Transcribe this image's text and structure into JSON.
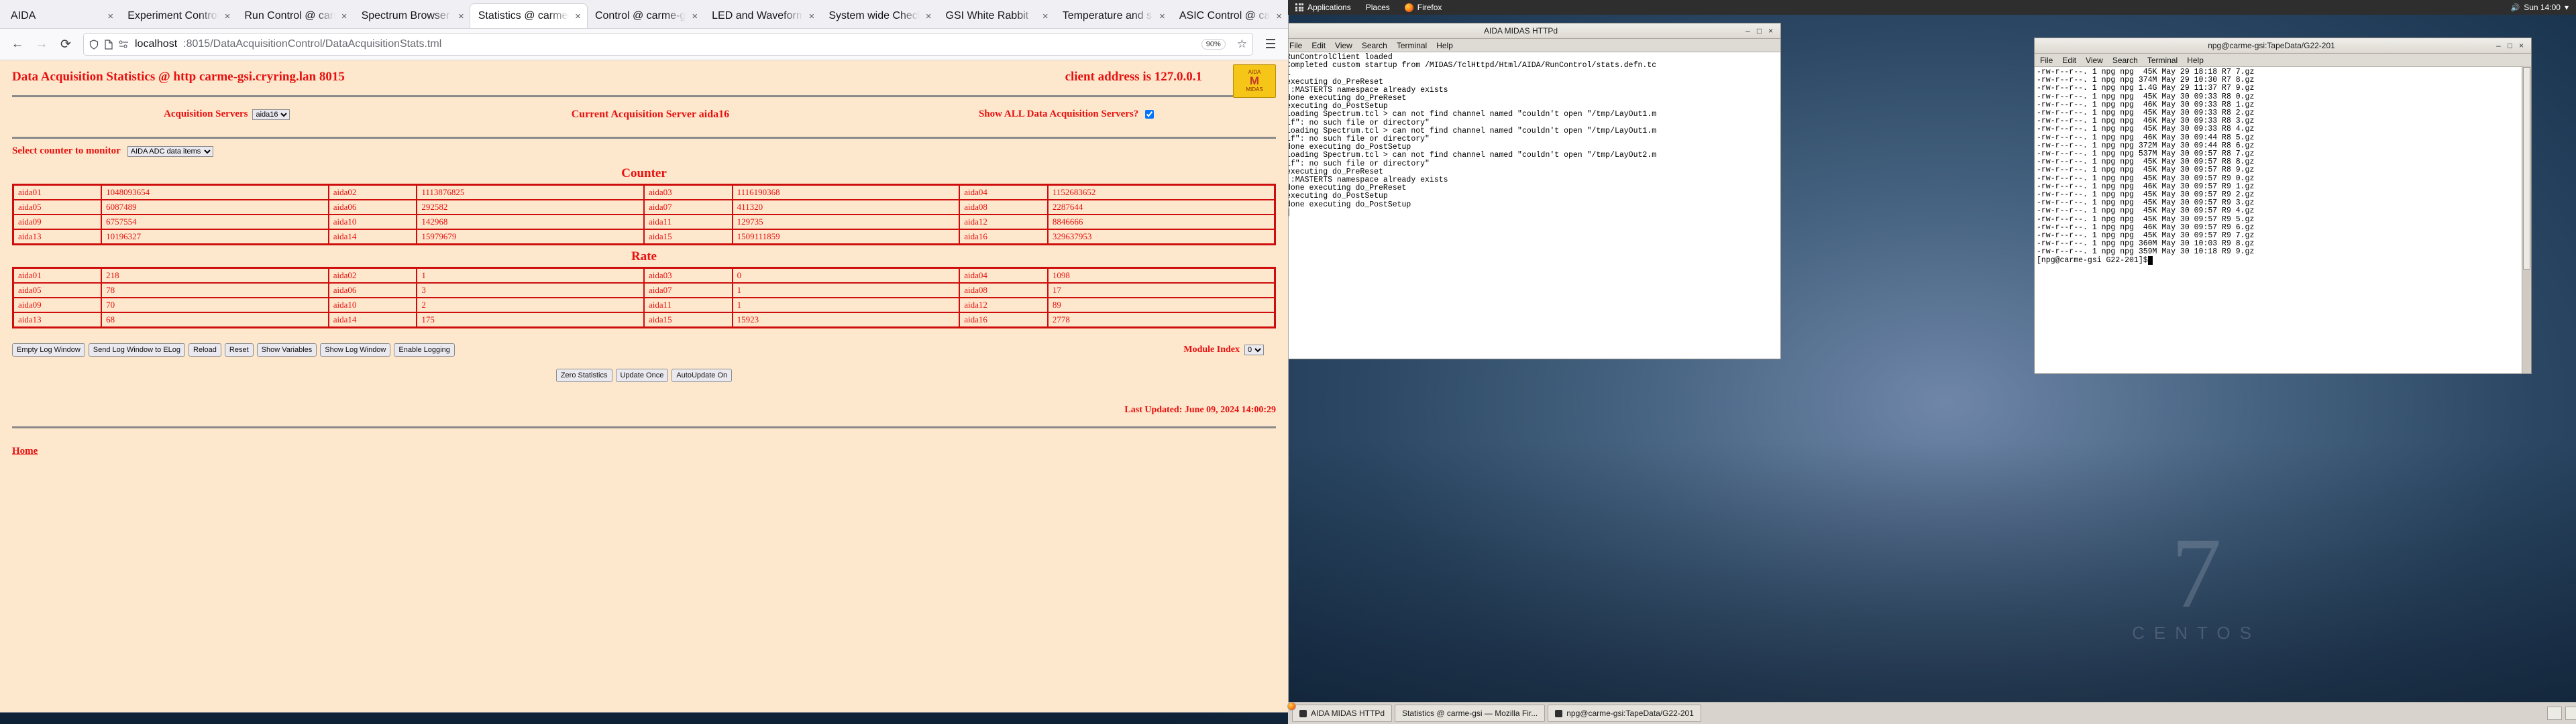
{
  "gnome_panel": {
    "activities": "Applications",
    "places": "Places",
    "app": "Firefox",
    "clock": "Sun 14:00"
  },
  "browser": {
    "tabs": [
      {
        "label": "AIDA",
        "active": false
      },
      {
        "label": "Experiment Control @",
        "active": false
      },
      {
        "label": "Run Control @ carme",
        "active": false
      },
      {
        "label": "Spectrum Browser @",
        "active": false
      },
      {
        "label": "Statistics @ carme-",
        "active": true
      },
      {
        "label": "Control @ carme-g",
        "active": false
      },
      {
        "label": "LED and Waveform",
        "active": false
      },
      {
        "label": "System wide Check",
        "active": false
      },
      {
        "label": "GSI White Rabbit",
        "active": false
      },
      {
        "label": "Temperature and s",
        "active": false
      },
      {
        "label": "ASIC Control @ ca",
        "active": false
      }
    ],
    "close_glyph": "×",
    "nav": {
      "back": "←",
      "forward": "→",
      "reload": "⟳"
    },
    "url_host": "localhost",
    "url_rest": ":8015/DataAcquisitionControl/DataAcquisitionStats.tml",
    "zoom_level": "90%",
    "shield_icon": "shield-icon",
    "page_icon": "page-icon",
    "reader_icon": "reader-icon",
    "bookmark_icon": "☆"
  },
  "page": {
    "title": "Data Acquisition Statistics @ http carme-gsi.cryring.lan 8015",
    "client_address": "client address is 127.0.0.1",
    "acq_servers_label": "Acquisition Servers",
    "acq_servers_value": "aida16",
    "current_server": "Current Acquisition Server aida16",
    "show_all_label": "Show ALL Data Acquisition Servers?",
    "show_all_checked": true,
    "select_counter_label": "Select counter to monitor",
    "select_counter_value": "AIDA ADC data items",
    "counter_title": "Counter",
    "rate_title": "Rate",
    "log_buttons": [
      "Empty Log Window",
      "Send Log Window to ELog",
      "Reload",
      "Reset",
      "Show Variables",
      "Show Log Window",
      "Enable Logging"
    ],
    "action_buttons": [
      "Zero Statistics",
      "Update Once",
      "AutoUpdate On"
    ],
    "module_index_label": "Module Index",
    "module_index_value": "0",
    "last_updated": "Last Updated: June 09, 2024 14:00:29",
    "home_link": "Home",
    "logo": {
      "top": "AIDA",
      "mark": "M",
      "bottom": "MIDAS"
    }
  },
  "chart_data": {
    "type": "table",
    "title": "Data Acquisition Statistics",
    "tables": [
      {
        "title": "Counter",
        "categories": [
          "aida01",
          "aida02",
          "aida03",
          "aida04",
          "aida05",
          "aida06",
          "aida07",
          "aida08",
          "aida09",
          "aida10",
          "aida11",
          "aida12",
          "aida13",
          "aida14",
          "aida15",
          "aida16"
        ],
        "values": [
          1048093654,
          1113876825,
          1116190368,
          1152683652,
          6087489,
          292582,
          411320,
          2287644,
          6757554,
          142968,
          129735,
          8846666,
          10196327,
          15979679,
          1509111859,
          329637953
        ]
      },
      {
        "title": "Rate",
        "categories": [
          "aida01",
          "aida02",
          "aida03",
          "aida04",
          "aida05",
          "aida06",
          "aida07",
          "aida08",
          "aida09",
          "aida10",
          "aida11",
          "aida12",
          "aida13",
          "aida14",
          "aida15",
          "aida16"
        ],
        "values": [
          218,
          1,
          0,
          1098,
          78,
          3,
          1,
          17,
          70,
          2,
          1,
          89,
          68,
          175,
          15923,
          2778
        ]
      }
    ]
  },
  "midas_window": {
    "title": "AIDA MIDAS HTTPd",
    "menu": [
      "File",
      "Edit",
      "View",
      "Search",
      "Terminal",
      "Help"
    ],
    "min_glyph": "–",
    "max_glyph": "□",
    "close_glyph": "×",
    "body": "RunControlClient loaded\nCompleted custom startup from /MIDAS/TclHttpd/Html/AIDA/RunControl/stats.defn.tc\nl\nexecuting do_PreReset\n::MASTERTS namespace already exists\ndone executing do_PreReset\nexecuting do_PostSetup\nloading Spectrum.tcl > can not find channel named \"couldn't open \"/tmp/LayOut1.m\nlf\": no such file or directory\"\nloading Spectrum.tcl > can not find channel named \"couldn't open \"/tmp/LayOut1.m\nlf\": no such file or directory\"\ndone executing do_PostSetup\nloading Spectrum.tcl > can not find channel named \"couldn't open \"/tmp/LayOut2.m\nlf\": no such file or directory\"\nexecuting do_PreReset\n::MASTERTS namespace already exists\ndone executing do_PreReset\nexecuting do_PostSetup\ndone executing do_PostSetup\n]"
  },
  "tape_window": {
    "title": "npg@carme-gsi:TapeData/G22-201",
    "menu": [
      "File",
      "Edit",
      "View",
      "Search",
      "Terminal",
      "Help"
    ],
    "min_glyph": "–",
    "max_glyph": "□",
    "close_glyph": "×",
    "body": "-rw-r--r--. 1 npg npg  45K May 29 18:18 R7 7.gz\n-rw-r--r--. 1 npg npg 374M May 29 10:30 R7 8.gz\n-rw-r--r--. 1 npg npg 1.4G May 29 11:37 R7 9.gz\n-rw-r--r--. 1 npg npg  45K May 30 09:33 R8 0.gz\n-rw-r--r--. 1 npg npg  46K May 30 09:33 R8 1.gz\n-rw-r--r--. 1 npg npg  45K May 30 09:33 R8 2.gz\n-rw-r--r--. 1 npg npg  46K May 30 09:33 R8 3.gz\n-rw-r--r--. 1 npg npg  45K May 30 09:33 R8 4.gz\n-rw-r--r--. 1 npg npg  46K May 30 09:44 R8 5.gz\n-rw-r--r--. 1 npg npg 372M May 30 09:44 R8 6.gz\n-rw-r--r--. 1 npg npg 537M May 30 09:57 R8 7.gz\n-rw-r--r--. 1 npg npg  45K May 30 09:57 R8 8.gz\n-rw-r--r--. 1 npg npg  45K May 30 09:57 R8 9.gz\n-rw-r--r--. 1 npg npg  45K May 30 09:57 R9 0.gz\n-rw-r--r--. 1 npg npg  46K May 30 09:57 R9 1.gz\n-rw-r--r--. 1 npg npg  45K May 30 09:57 R9 2.gz\n-rw-r--r--. 1 npg npg  45K May 30 09:57 R9 3.gz\n-rw-r--r--. 1 npg npg  45K May 30 09:57 R9 4.gz\n-rw-r--r--. 1 npg npg  45K May 30 09:57 R9 5.gz\n-rw-r--r--. 1 npg npg  46K May 30 09:57 R9 6.gz\n-rw-r--r--. 1 npg npg  45K May 30 09:57 R9 7.gz\n-rw-r--r--. 1 npg npg 360M May 30 10:03 R9 8.gz\n-rw-r--r--. 1 npg npg 359M May 30 10:18 R9 9.gz",
    "prompt": "[npg@carme-gsi G22-201]$"
  },
  "taskbar": {
    "items": [
      {
        "label": "AIDA MIDAS HTTPd",
        "icon": "terminal-icon"
      },
      {
        "label": "Statistics @ carme-gsi — Mozilla Fir...",
        "icon": "firefox-icon"
      },
      {
        "label": "npg@carme-gsi:TapeData/G22-201",
        "icon": "terminal-icon"
      }
    ]
  },
  "desktop": {
    "brand_mark": "7",
    "brand_word": "CENTOS"
  }
}
